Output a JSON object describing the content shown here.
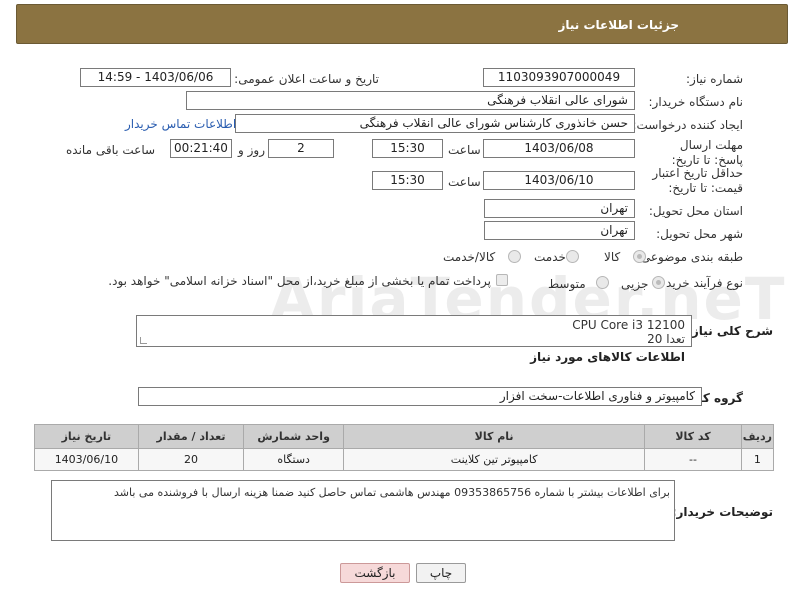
{
  "header": {
    "title": "جزئیات اطلاعات نیاز"
  },
  "fields": {
    "need_number_label": "شماره نیاز:",
    "need_number": "1103093907000049",
    "announce_label": "تاریخ و ساعت اعلان عمومی:",
    "announce_value": "1403/06/06 - 14:59",
    "buyer_org_label": "نام دستگاه خریدار:",
    "buyer_org": "شورای عالی انقلاب فرهنگی",
    "requester_label": "ایجاد کننده درخواست:",
    "requester": "حسن خانذوری کارشناس شورای عالی انقلاب فرهنگی",
    "buyer_contact_link": "اطلاعات تماس خریدار",
    "reply_deadline_label": "مهلت ارسال پاسخ: تا تاریخ:",
    "reply_date": "1403/06/08",
    "time_label": "ساعت",
    "reply_time": "15:30",
    "days_value": "2",
    "days_label": "روز و",
    "remaining_value": "00:21:40",
    "remaining_label": "ساعت باقی مانده",
    "price_validity_label": "حداقل تاریخ اعتبار قیمت: تا تاریخ:",
    "validity_date": "1403/06/10",
    "validity_time": "15:30",
    "province_label": "استان محل تحویل:",
    "province": "تهران",
    "city_label": "شهر محل تحویل:",
    "city": "تهران",
    "category_label": "طبقه بندی موضوعی:",
    "category_options": [
      "کالا",
      "خدمت",
      "کالا/خدمت"
    ],
    "purchase_type_label": "نوع فرآیند خرید :",
    "purchase_options": [
      "جزیی",
      "متوسط"
    ],
    "payment_note": "پرداخت تمام یا بخشی از مبلغ خرید،از محل \"اسناد خزانه اسلامی\" خواهد بود."
  },
  "summary": {
    "label": "شرح کلی نیاز:",
    "line1": "CPU  Core i3 12100",
    "line2": "تعدا 20"
  },
  "goods_info_title": "اطلاعات کالاهای مورد نیاز",
  "goods_group": {
    "label": "گروه کالا:",
    "value": "کامپیوتر و فناوری اطلاعات-سخت افزار"
  },
  "table": {
    "headers": [
      "ردیف",
      "کد کالا",
      "نام کالا",
      "واحد شمارش",
      "تعداد / مقدار",
      "تاریخ نیاز"
    ],
    "rows": [
      [
        "1",
        "--",
        "کامپیوتر تین کلاینت",
        "دستگاه",
        "20",
        "1403/06/10"
      ]
    ]
  },
  "buyer_notes": {
    "label": "توضیحات خریدار:",
    "text": "برای اطلاعات بیشتر با شماره 09353865756 مهندس هاشمی تماس حاصل کنید ضمنا هزینه ارسال با فروشنده می باشد"
  },
  "buttons": {
    "print": "چاپ",
    "back": "بازگشت"
  },
  "watermark": "AriaTender.neT"
}
